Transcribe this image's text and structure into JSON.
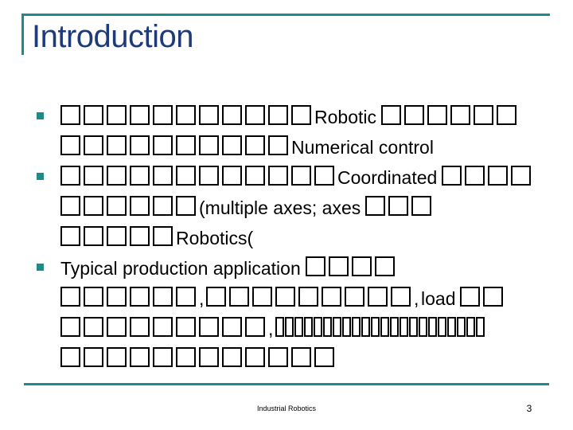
{
  "slide": {
    "title": "Introduction",
    "accent_color": "#1F8A8C",
    "title_color": "#1F3A79",
    "body_color": "#000000",
    "background_color": "#FFFFFF"
  },
  "bullets": [
    {
      "marker": "square-bullet",
      "lines": [
        {
          "segments": [
            {
              "type": "tofu",
              "count": 11
            },
            {
              "type": "text",
              "value": "Robotic"
            },
            {
              "type": "tofu",
              "count": 6
            }
          ]
        },
        {
          "segments": [
            {
              "type": "tofu",
              "count": 10
            },
            {
              "type": "text",
              "value": "Numerical control"
            }
          ]
        }
      ]
    },
    {
      "marker": "square-bullet",
      "lines": [
        {
          "segments": [
            {
              "type": "tofu",
              "count": 12
            },
            {
              "type": "text",
              "value": "Coordinated"
            },
            {
              "type": "tofu",
              "count": 4
            }
          ]
        },
        {
          "segments": [
            {
              "type": "tofu",
              "count": 6
            },
            {
              "type": "text",
              "value": "(multiple axes; axes"
            },
            {
              "type": "tofu",
              "count": 3
            }
          ]
        },
        {
          "segments": [
            {
              "type": "tofu",
              "count": 5
            },
            {
              "type": "text",
              "value": "Robotics("
            }
          ]
        }
      ]
    },
    {
      "marker": "square-bullet",
      "lines": [
        {
          "segments": [
            {
              "type": "text",
              "value": "Typical production application"
            },
            {
              "type": "tofu",
              "count": 4
            }
          ]
        },
        {
          "segments": [
            {
              "type": "tofu",
              "count": 6
            },
            {
              "type": "punct",
              "value": ","
            },
            {
              "type": "tofu",
              "count": 9
            },
            {
              "type": "punct",
              "value": ","
            },
            {
              "type": "text",
              "value": "load"
            },
            {
              "type": "tofu",
              "count": 2
            }
          ]
        },
        {
          "segments": [
            {
              "type": "tofu",
              "count": 9
            },
            {
              "type": "punct",
              "value": ","
            },
            {
              "type": "tofu-narrow",
              "count": 22
            }
          ]
        },
        {
          "segments": [
            {
              "type": "tofu",
              "count": 12
            }
          ]
        }
      ]
    }
  ],
  "footer": {
    "text": "Industrial Robotics",
    "page_number": "3"
  }
}
